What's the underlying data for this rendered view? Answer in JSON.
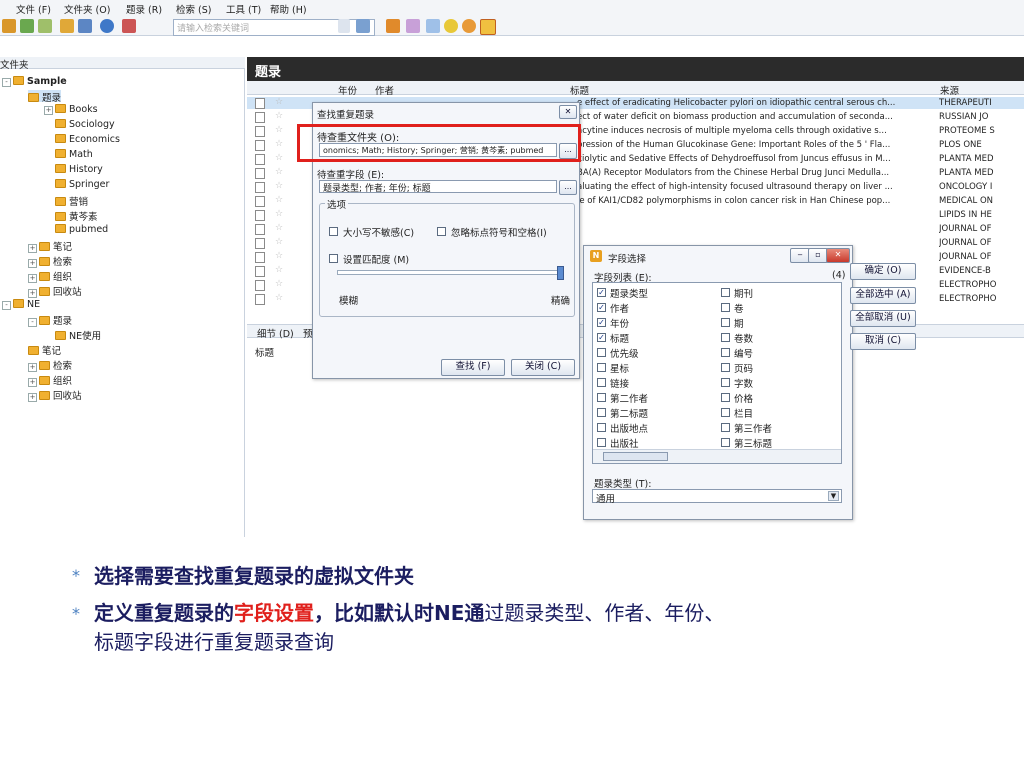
{
  "menu": [
    "文件 (F)",
    "文件夹 (O)",
    "题录 (R)",
    "检索 (S)",
    "工具 (T)",
    "帮助 (H)"
  ],
  "toolbar": {
    "search_placeholder": "请输入检索关键词"
  },
  "tree": {
    "header": "文件夹",
    "nodes": [
      {
        "label": "Sample",
        "bold": true
      },
      {
        "label": "题录",
        "selected": true
      },
      {
        "label": "Books"
      },
      {
        "label": "Sociology"
      },
      {
        "label": "Economics"
      },
      {
        "label": "Math"
      },
      {
        "label": "History"
      },
      {
        "label": "Springer"
      },
      {
        "label": "营销"
      },
      {
        "label": "黄芩素"
      },
      {
        "label": "pubmed"
      },
      {
        "label": "笔记"
      },
      {
        "label": "检索"
      },
      {
        "label": "组织"
      },
      {
        "label": "回收站"
      },
      {
        "label": "NE"
      },
      {
        "label": "题录"
      },
      {
        "label": "NE使用"
      },
      {
        "label": "笔记"
      },
      {
        "label": "检索"
      },
      {
        "label": "组织"
      },
      {
        "label": "回收站"
      }
    ]
  },
  "panel": {
    "title": "题录",
    "columns": {
      "year": "年份",
      "author": "作者",
      "title": "标题",
      "source": "来源"
    },
    "rows": [
      {
        "title": "e effect of eradicating Helicobacter pylori on idiopathic central serous ch...",
        "source": "THERAPEUTI"
      },
      {
        "title": "ect of water deficit on biomass production and accumulation of seconda...",
        "source": "RUSSIAN JO"
      },
      {
        "title": "acytine induces necrosis of multiple myeloma cells through oxidative s...",
        "source": "PROTEOME S"
      },
      {
        "title": "pression of the Human Glucokinase Gene: Important Roles of the 5 ' Fla...",
        "source": "PLOS ONE"
      },
      {
        "title": "xiolytic and Sedative Effects of Dehydroeffusol from Juncus effusus in M...",
        "source": "PLANTA MED"
      },
      {
        "title": "BA(A) Receptor Modulators from the Chinese Herbal Drug Junci Medulla...",
        "source": "PLANTA MED"
      },
      {
        "title": "aluating the effect of high-intensity focused ultrasound therapy on liver ...",
        "source": "ONCOLOGY I"
      },
      {
        "title": "le of KAI1/CD82 polymorphisms in colon cancer risk in Han Chinese pop...",
        "source": "MEDICAL ON"
      },
      {
        "title": "",
        "source": "LIPIDS IN HE"
      },
      {
        "title": "",
        "source": "JOURNAL OF"
      },
      {
        "title": "",
        "source": "JOURNAL OF"
      },
      {
        "title": "",
        "source": "JOURNAL OF"
      },
      {
        "title": "",
        "source": "EVIDENCE-B"
      },
      {
        "title": "",
        "source": "ELECTROPHO"
      },
      {
        "title": "",
        "source": "ELECTROPHO"
      }
    ],
    "details_tab": "细节 (D)",
    "details_tab2": "预",
    "details_field": "标题"
  },
  "dialog_find": {
    "title": "查找重复题录",
    "folders_label": "待查重文件夹 (O):",
    "folders_value": "onomics; Math; History; Springer; 营销; 黄芩素; pubmed",
    "fields_label": "待查重字段 (E):",
    "fields_value": "题录类型; 作者; 年份; 标题",
    "options_label": "选项",
    "case_insensitive": "大小写不敏感(C)",
    "ignore_punct": "忽略标点符号和空格(I)",
    "match_degree": "设置匹配度 (M)",
    "fuzzy": "模糊",
    "exact": "精确",
    "find_btn": "查找 (F)",
    "close_btn": "关闭 (C)",
    "ellipsis": "..."
  },
  "dialog_fields": {
    "title": "字段选择",
    "list_label": "字段列表 (E):",
    "count": "(4)",
    "col1": [
      {
        "label": "题录类型",
        "checked": true
      },
      {
        "label": "作者",
        "checked": true
      },
      {
        "label": "年份",
        "checked": true
      },
      {
        "label": "标题",
        "checked": true
      },
      {
        "label": "优先级",
        "checked": false
      },
      {
        "label": "星标",
        "checked": false
      },
      {
        "label": "链接",
        "checked": false
      },
      {
        "label": "第二作者",
        "checked": false
      },
      {
        "label": "第二标题",
        "checked": false
      },
      {
        "label": "出版地点",
        "checked": false
      },
      {
        "label": "出版社",
        "checked": false
      }
    ],
    "col2": [
      {
        "label": "期刊",
        "checked": false
      },
      {
        "label": "卷",
        "checked": false
      },
      {
        "label": "期",
        "checked": false
      },
      {
        "label": "卷数",
        "checked": false
      },
      {
        "label": "编号",
        "checked": false
      },
      {
        "label": "页码",
        "checked": false
      },
      {
        "label": "字数",
        "checked": false
      },
      {
        "label": "价格",
        "checked": false
      },
      {
        "label": "栏目",
        "checked": false
      },
      {
        "label": "第三作者",
        "checked": false
      },
      {
        "label": "第三标题",
        "checked": false
      }
    ],
    "ok_btn": "确定 (O)",
    "select_all_btn": "全部选中 (A)",
    "deselect_all_btn": "全部取消 (U)",
    "cancel_btn": "取消 (C)",
    "type_label": "题录类型 (T):",
    "type_value": "通用"
  },
  "bullets": {
    "b1": {
      "p1": "选择需要查找重复题录的虚拟",
      "p2": "文件夹"
    },
    "b2": {
      "p1": "定义重复",
      "p2": "题录的",
      "p3": "字段设置",
      "p4": "，比如默",
      "p5": "认时NE通",
      "p6": "过题录类型、作者、年份、"
    },
    "b2_line2": "标题字段进行重复题录查询"
  },
  "colors": {
    "accent_red": "#e0201c",
    "bullet_text": "#1b1d60",
    "bullet_star": "#4a7fc0"
  }
}
